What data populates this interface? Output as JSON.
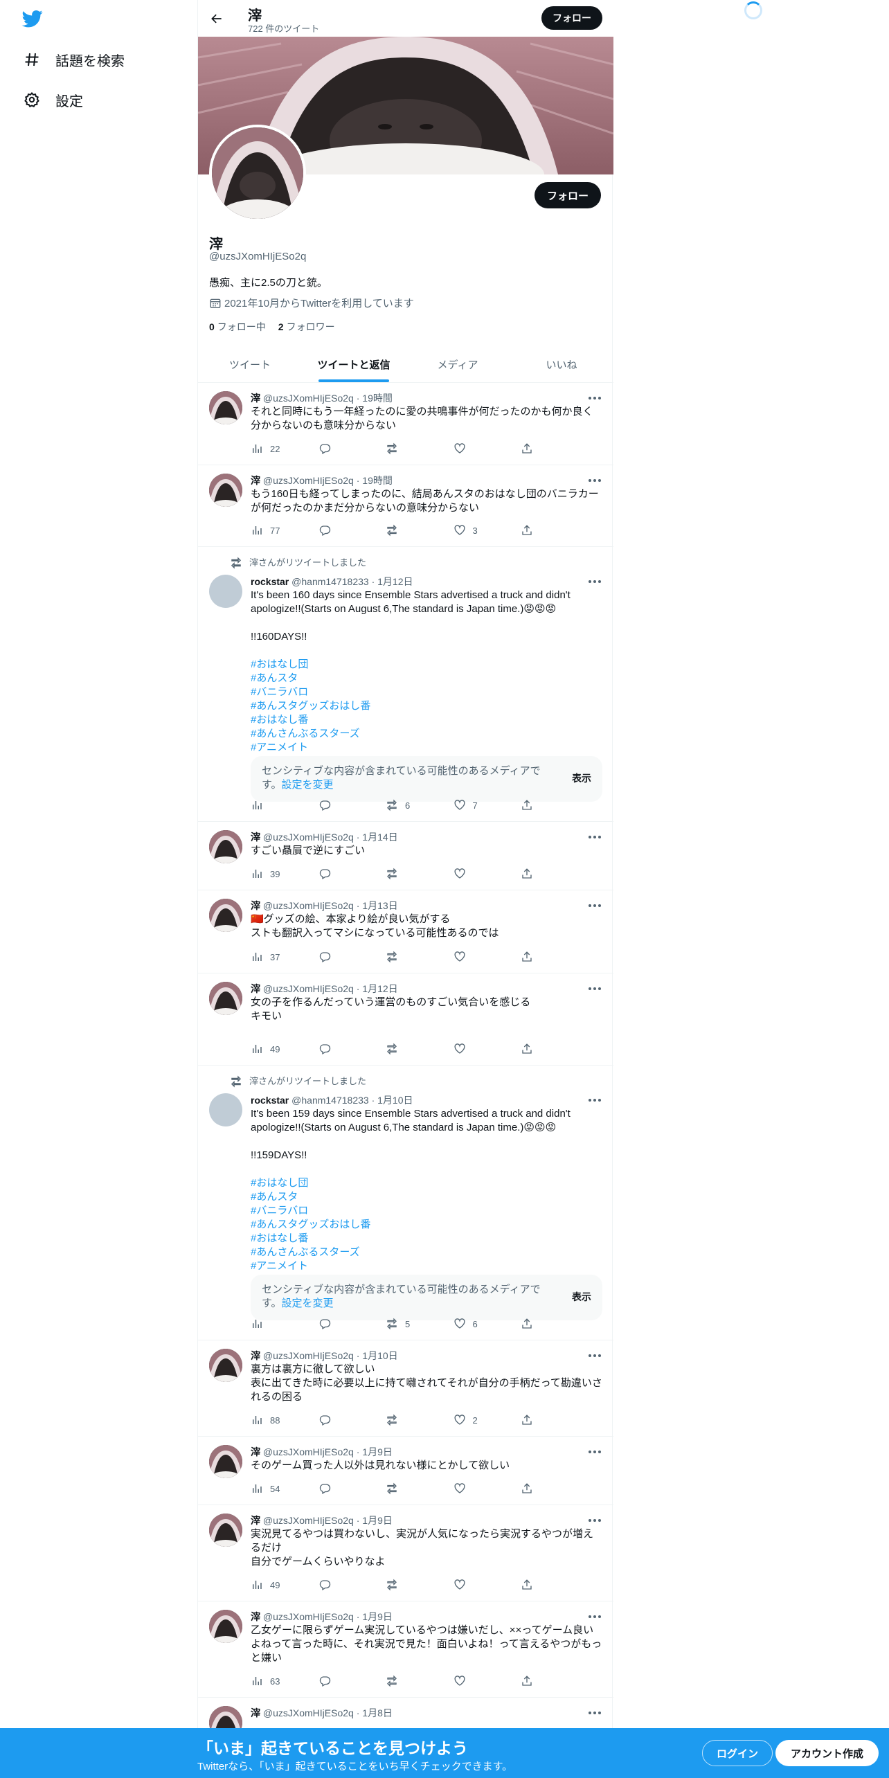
{
  "nav": {
    "explore_label": "話題を検索",
    "settings_label": "設定"
  },
  "header": {
    "name": "滓",
    "tweet_count": "722 件のツイート",
    "follow_label": "フォロー"
  },
  "profile": {
    "name": "滓",
    "handle": "@uzsJXomHIjESo2q",
    "bio": "愚痴、主に2.5の刀と銃。",
    "joined": "2021年10月からTwitterを利用しています",
    "following_count": "0",
    "following_label": "フォロー中",
    "followers_count": "2",
    "followers_label": "フォロワー",
    "follow_label": "フォロー"
  },
  "tabs": [
    {
      "label": "ツイート"
    },
    {
      "label": "ツイートと返信"
    },
    {
      "label": "メディア"
    },
    {
      "label": "いいね"
    }
  ],
  "tweets": [
    {
      "name": "滓",
      "handle": "@uzsJXomHIjESo2q",
      "time": "19時間",
      "text": "それと同時にもう一年経ったのに愛の共鳴事件が何だったのかも何か良く分からないのも意味分からない",
      "views": "22",
      "retweets": "",
      "likes": ""
    },
    {
      "name": "滓",
      "handle": "@uzsJXomHIjESo2q",
      "time": "19時間",
      "text": "もう160日も経ってしまったのに、結局あんスタのおはなし団のバニラカーが何だったのかまだ分からないの意味分からない",
      "views": "77",
      "retweets": "",
      "likes": "3"
    },
    {
      "retweeted_by": "滓さんがリツイートしました",
      "name": "rockstar",
      "handle": "@hanm14718233",
      "time": "1月12日",
      "text": "It's been 160 days since Ensemble Stars advertised a truck and didn't apologize!!(Starts on August 6,The standard is Japan time.)😡😡😡\n\n!!160DAYS!!",
      "hashtags": [
        "#おはなし団",
        "#あんスタ",
        "#バニラバロ",
        "#あんスタグッズおはし番",
        "#おはなし番",
        "#あんさんぶるスターズ",
        "#アニメイト"
      ],
      "sensitive": "センシティブな内容が含まれている可能性のあるメディアです。",
      "sensitive_link": "設定を変更",
      "show_label": "表示",
      "views": "",
      "retweets": "6",
      "likes": "7"
    },
    {
      "name": "滓",
      "handle": "@uzsJXomHIjESo2q",
      "time": "1月14日",
      "text": "すごい贔屓で逆にすごい",
      "views": "39",
      "retweets": "",
      "likes": ""
    },
    {
      "name": "滓",
      "handle": "@uzsJXomHIjESo2q",
      "time": "1月13日",
      "text": "🇨🇳グッズの絵、本家より絵が良い気がする\nストも翻訳入ってマシになっている可能性あるのでは",
      "views": "37",
      "retweets": "",
      "likes": ""
    },
    {
      "name": "滓",
      "handle": "@uzsJXomHIjESo2q",
      "time": "1月12日",
      "text": "女の子を作るんだっていう運営のものすごい気合いを感じる\nキモい",
      "views": "49",
      "retweets": "",
      "likes": ""
    },
    {
      "retweeted_by": "滓さんがリツイートしました",
      "name": "rockstar",
      "handle": "@hanm14718233",
      "time": "1月10日",
      "text": "It's been 159 days since Ensemble Stars advertised a truck and didn't apologize!!(Starts on August 6,The standard is Japan time.)😡😡😡\n\n!!159DAYS!!",
      "hashtags": [
        "#おはなし団",
        "#あんスタ",
        "#バニラバロ",
        "#あんスタグッズおはし番",
        "#おはなし番",
        "#あんさんぶるスターズ",
        "#アニメイト"
      ],
      "sensitive": "センシティブな内容が含まれている可能性のあるメディアです。",
      "sensitive_link": "設定を変更",
      "show_label": "表示",
      "views": "",
      "retweets": "5",
      "likes": "6"
    },
    {
      "name": "滓",
      "handle": "@uzsJXomHIjESo2q",
      "time": "1月10日",
      "text": "裏方は裏方に徹して欲しい\n表に出てきた時に必要以上に持て囃されてそれが自分の手柄だって勘違いされるの困る",
      "views": "88",
      "retweets": "",
      "likes": "2"
    },
    {
      "name": "滓",
      "handle": "@uzsJXomHIjESo2q",
      "time": "1月9日",
      "text": "そのゲーム買った人以外は見れない様にとかして欲しい",
      "views": "54",
      "retweets": "",
      "likes": ""
    },
    {
      "name": "滓",
      "handle": "@uzsJXomHIjESo2q",
      "time": "1月9日",
      "text": "実況見てるやつは買わないし、実況が人気になったら実況するやつが増えるだけ\n自分でゲームくらいやりなよ",
      "views": "49",
      "retweets": "",
      "likes": ""
    },
    {
      "name": "滓",
      "handle": "@uzsJXomHIjESo2q",
      "time": "1月9日",
      "text": "乙女ゲーに限らずゲーム実況しているやつは嫌いだし、××ってゲーム良いよねって言った時に、それ実況で見た！面白いよね！って言えるやつがもっと嫌い",
      "views": "63",
      "retweets": "",
      "likes": ""
    },
    {
      "name": "滓",
      "handle": "@uzsJXomHIjESo2q",
      "time": "1月8日",
      "text": "",
      "views": "",
      "retweets": "",
      "likes": ""
    }
  ],
  "bottom": {
    "title": "「いま」起きていることを見つけよう",
    "subtitle": "Twitterなら、「いま」起きていることをいち早くチェックできます。",
    "login": "ログイン",
    "signup": "アカウント作成"
  },
  "colors": {
    "accent": "#1d9bf0",
    "text": "#0f1419",
    "secondary": "#536471",
    "button_dark": "#0f1419"
  }
}
